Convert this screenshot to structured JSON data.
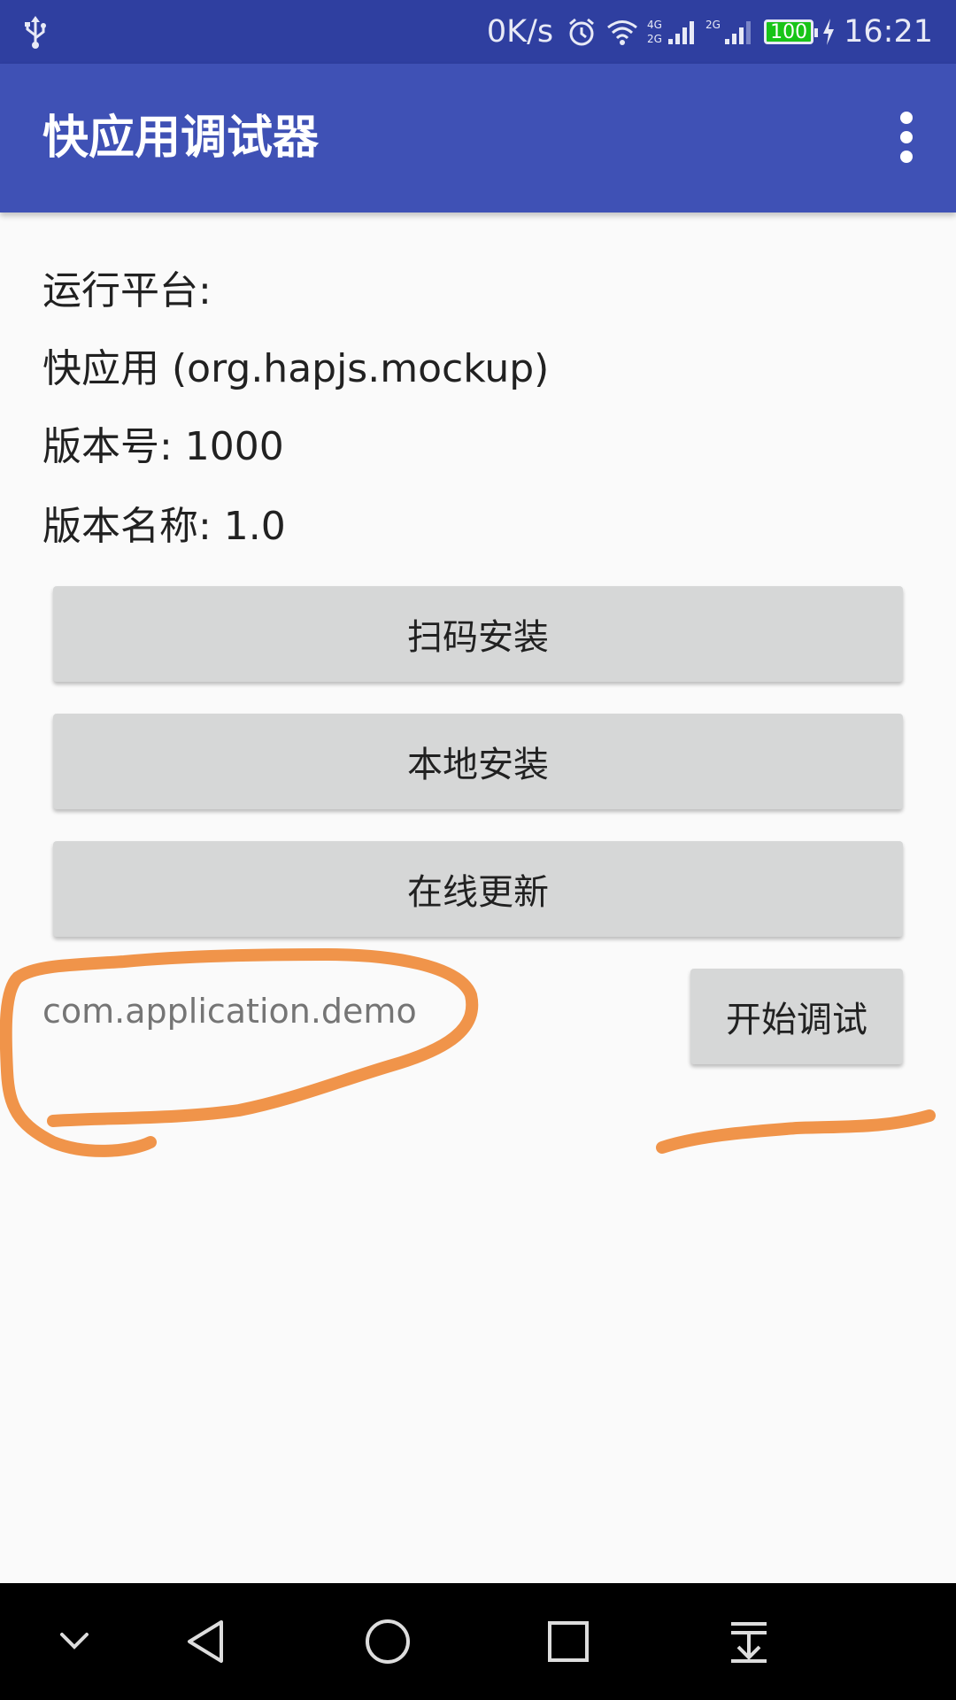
{
  "status_bar": {
    "network_speed": "0K/s",
    "net_type_1": "4G",
    "net_type_2": "2G",
    "battery": "100",
    "time": "16:21"
  },
  "app_bar": {
    "title": "快应用调试器"
  },
  "info": {
    "platform_label": "运行平台:",
    "platform_value": "快应用 (org.hapjs.mockup)",
    "version_code": "版本号: 1000",
    "version_name": "版本名称: 1.0"
  },
  "buttons": {
    "scan_install": "扫码安装",
    "local_install": "本地安装",
    "online_update": "在线更新",
    "start_debug": "开始调试"
  },
  "package_field": {
    "value": "com.application.demo"
  },
  "colors": {
    "status_bar": "#2f3fa0",
    "app_bar": "#3f51b5",
    "button": "#d6d7d7",
    "annotation": "#f0944a"
  }
}
